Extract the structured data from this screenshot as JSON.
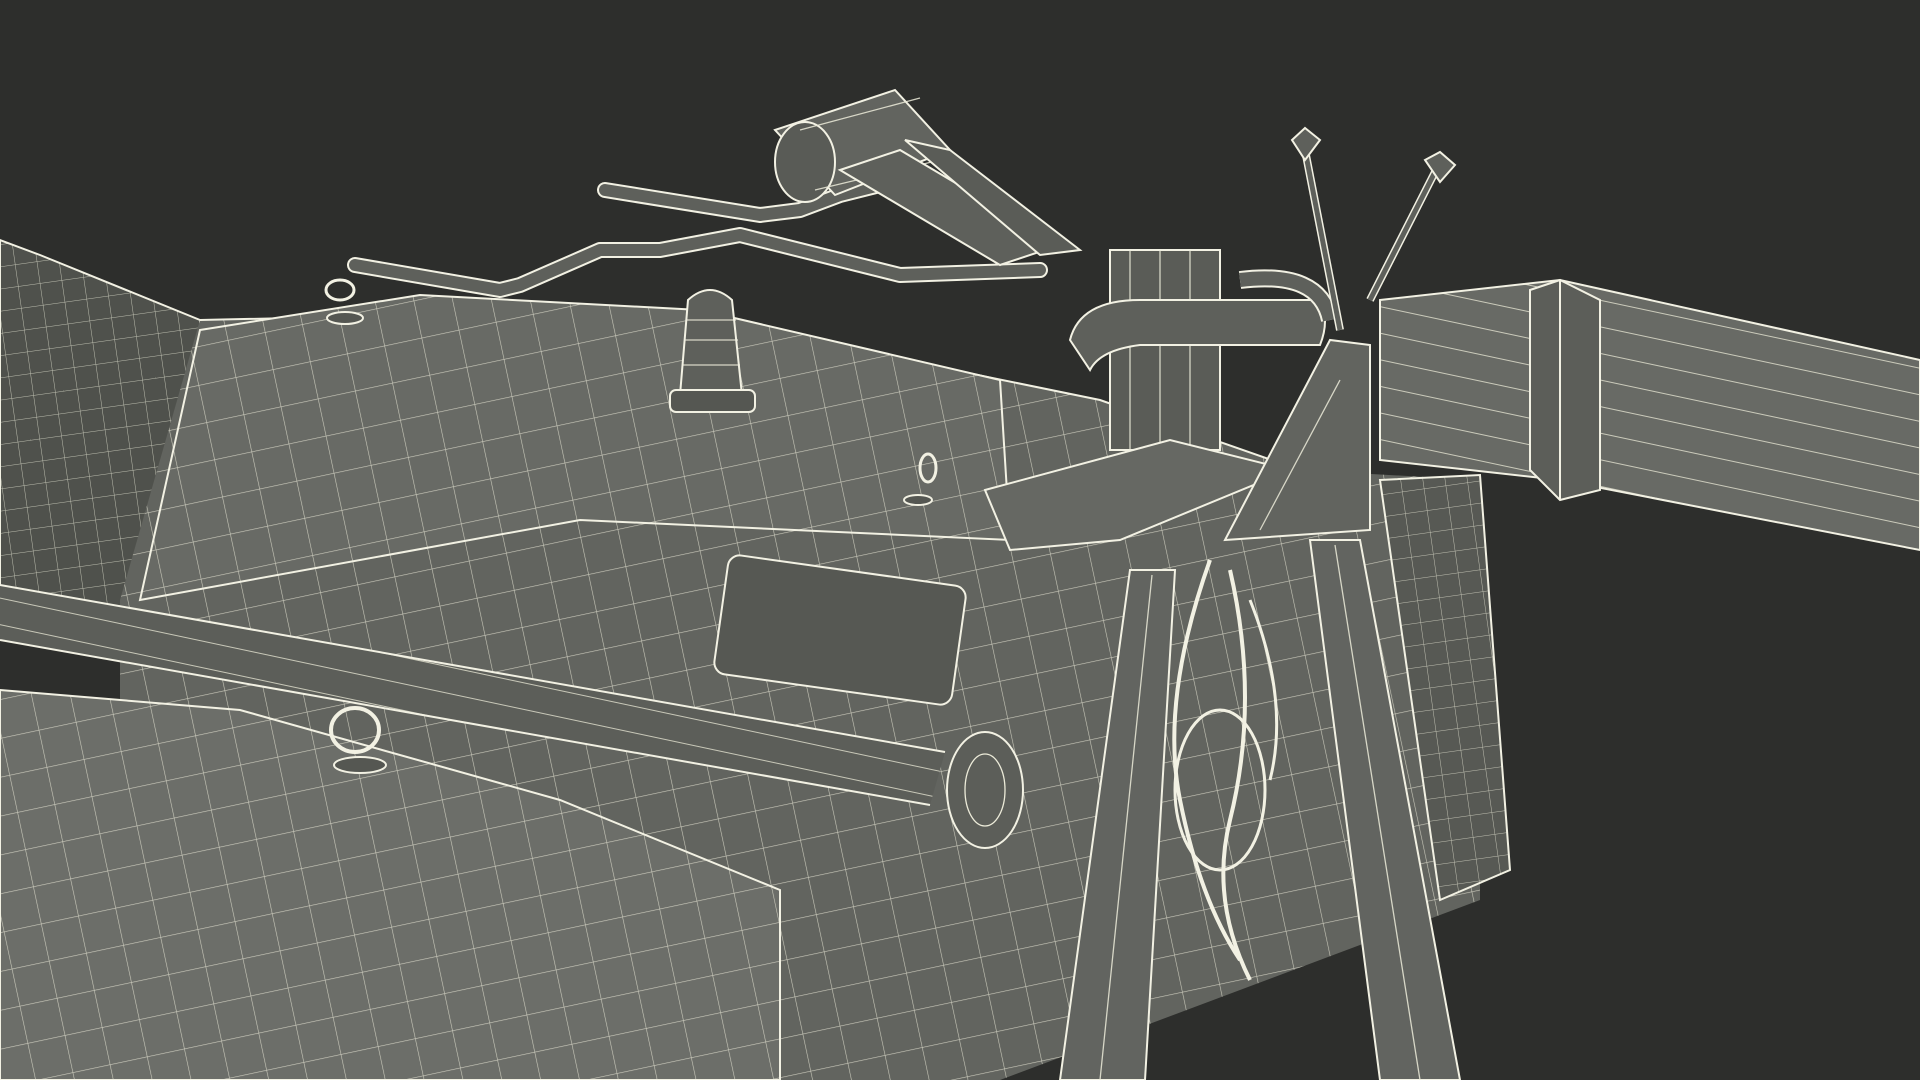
{
  "scene": {
    "background_color": "#2d2e2c",
    "surface_color": "#62645f",
    "surface_dark_color": "#4f514c",
    "wire_color": "#ecebd9"
  }
}
